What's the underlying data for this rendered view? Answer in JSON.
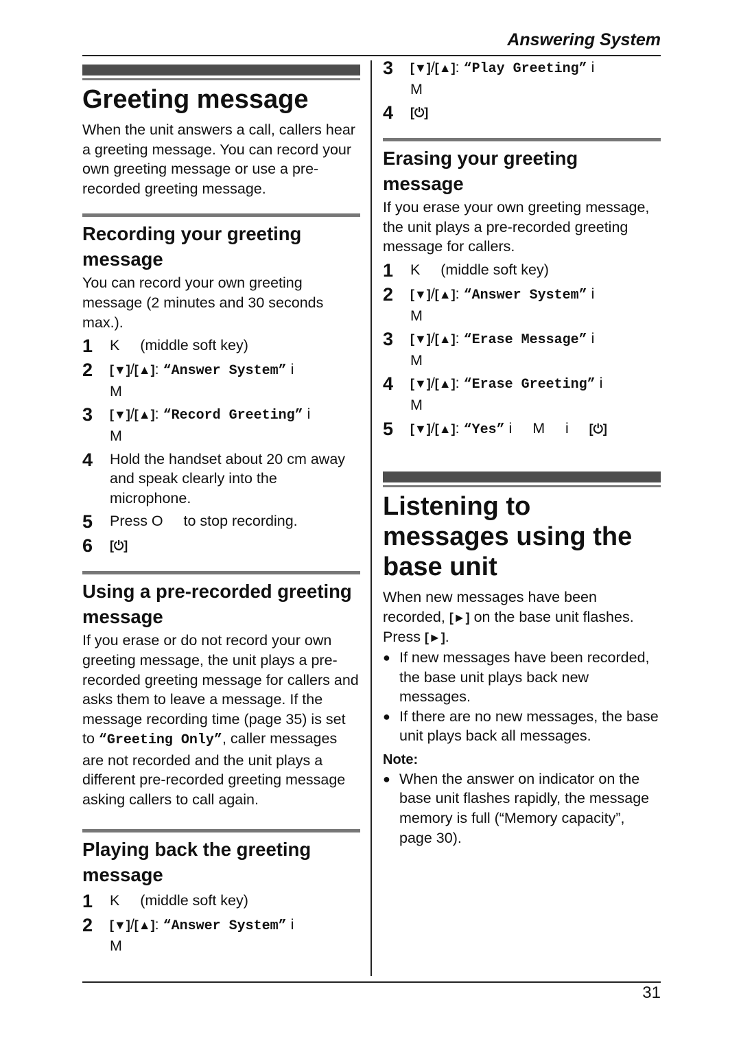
{
  "header": {
    "section_title": "Answering System"
  },
  "footer": {
    "page_number": "31"
  },
  "icons": {
    "down_key": "[▼]",
    "up_key": "[▲]",
    "off_key": "[⏻]",
    "play_key": "[►]",
    "bullet": "●"
  },
  "left": {
    "title": "Greeting message",
    "intro": "When the unit answers a call, callers hear a greeting message. You can record your own greeting message or use a pre-recorded greeting message.",
    "recording": {
      "heading": "Recording your greeting message",
      "intro": "You can record your own greeting message (2 minutes and 30 seconds max.).",
      "steps": [
        {
          "num": "1",
          "text": "K     (middle soft key)"
        },
        {
          "num": "2",
          "sep": ": ",
          "item": "“Answer System”",
          "tail": " i",
          "line2": "M"
        },
        {
          "num": "3",
          "sep": ": ",
          "item": "“Record Greeting”",
          "tail": " i",
          "line2": "M"
        },
        {
          "num": "4",
          "text": "Hold the handset about 20 cm away and speak clearly into the microphone."
        },
        {
          "num": "5",
          "text": "Press O     to stop recording."
        },
        {
          "num": "6",
          "text": ""
        }
      ]
    },
    "prerecorded": {
      "heading": "Using a pre-recorded greeting message",
      "body_before": "If you erase or do not record your own greeting message, the unit plays a pre-recorded greeting message for callers and asks them to leave a message. If the message recording time (page 35) is set to ",
      "body_mono": "“Greeting Only”",
      "body_after": ", caller messages are not recorded and the unit plays a different pre-recorded greeting message asking callers to call again."
    },
    "playing": {
      "heading": "Playing back the greeting message",
      "steps": [
        {
          "num": "1",
          "text": "K     (middle soft key)"
        },
        {
          "num": "2",
          "sep": ": ",
          "item": "“Answer System”",
          "tail": " i",
          "line2": "M"
        }
      ]
    }
  },
  "right": {
    "playing_cont": {
      "steps": [
        {
          "num": "3",
          "sep": ": ",
          "item": "“Play Greeting”",
          "tail": " i",
          "line2": "M"
        },
        {
          "num": "4",
          "text": ""
        }
      ]
    },
    "erasing": {
      "heading": "Erasing your greeting message",
      "intro": "If you erase your own greeting message, the unit plays a pre-recorded greeting message for callers.",
      "steps": [
        {
          "num": "1",
          "text": "K     (middle soft key)"
        },
        {
          "num": "2",
          "sep": ": ",
          "item": "“Answer System”",
          "tail": " i",
          "line2": "M"
        },
        {
          "num": "3",
          "sep": ": ",
          "item": "“Erase Message”",
          "tail": " i",
          "line2": "M"
        },
        {
          "num": "4",
          "sep": ": ",
          "item": "“Erase Greeting”",
          "tail": " i",
          "line2": "M"
        },
        {
          "num": "5",
          "sep": ": ",
          "item": "“Yes”",
          "tail": " i     M     i     "
        }
      ]
    },
    "listening": {
      "title": "Listening to messages using the base unit",
      "intro_1": "When new messages have been recorded, ",
      "intro_2": " on the base unit flashes. Press ",
      "intro_3": ".",
      "bullets": [
        "If new messages have been recorded, the base unit plays back new messages.",
        "If there are no new messages, the base unit plays back all messages."
      ],
      "note_label": "Note:",
      "note_bullets": [
        "When the answer on indicator on the base unit flashes rapidly, the message memory is full (“Memory capacity”, page 30)."
      ]
    }
  }
}
